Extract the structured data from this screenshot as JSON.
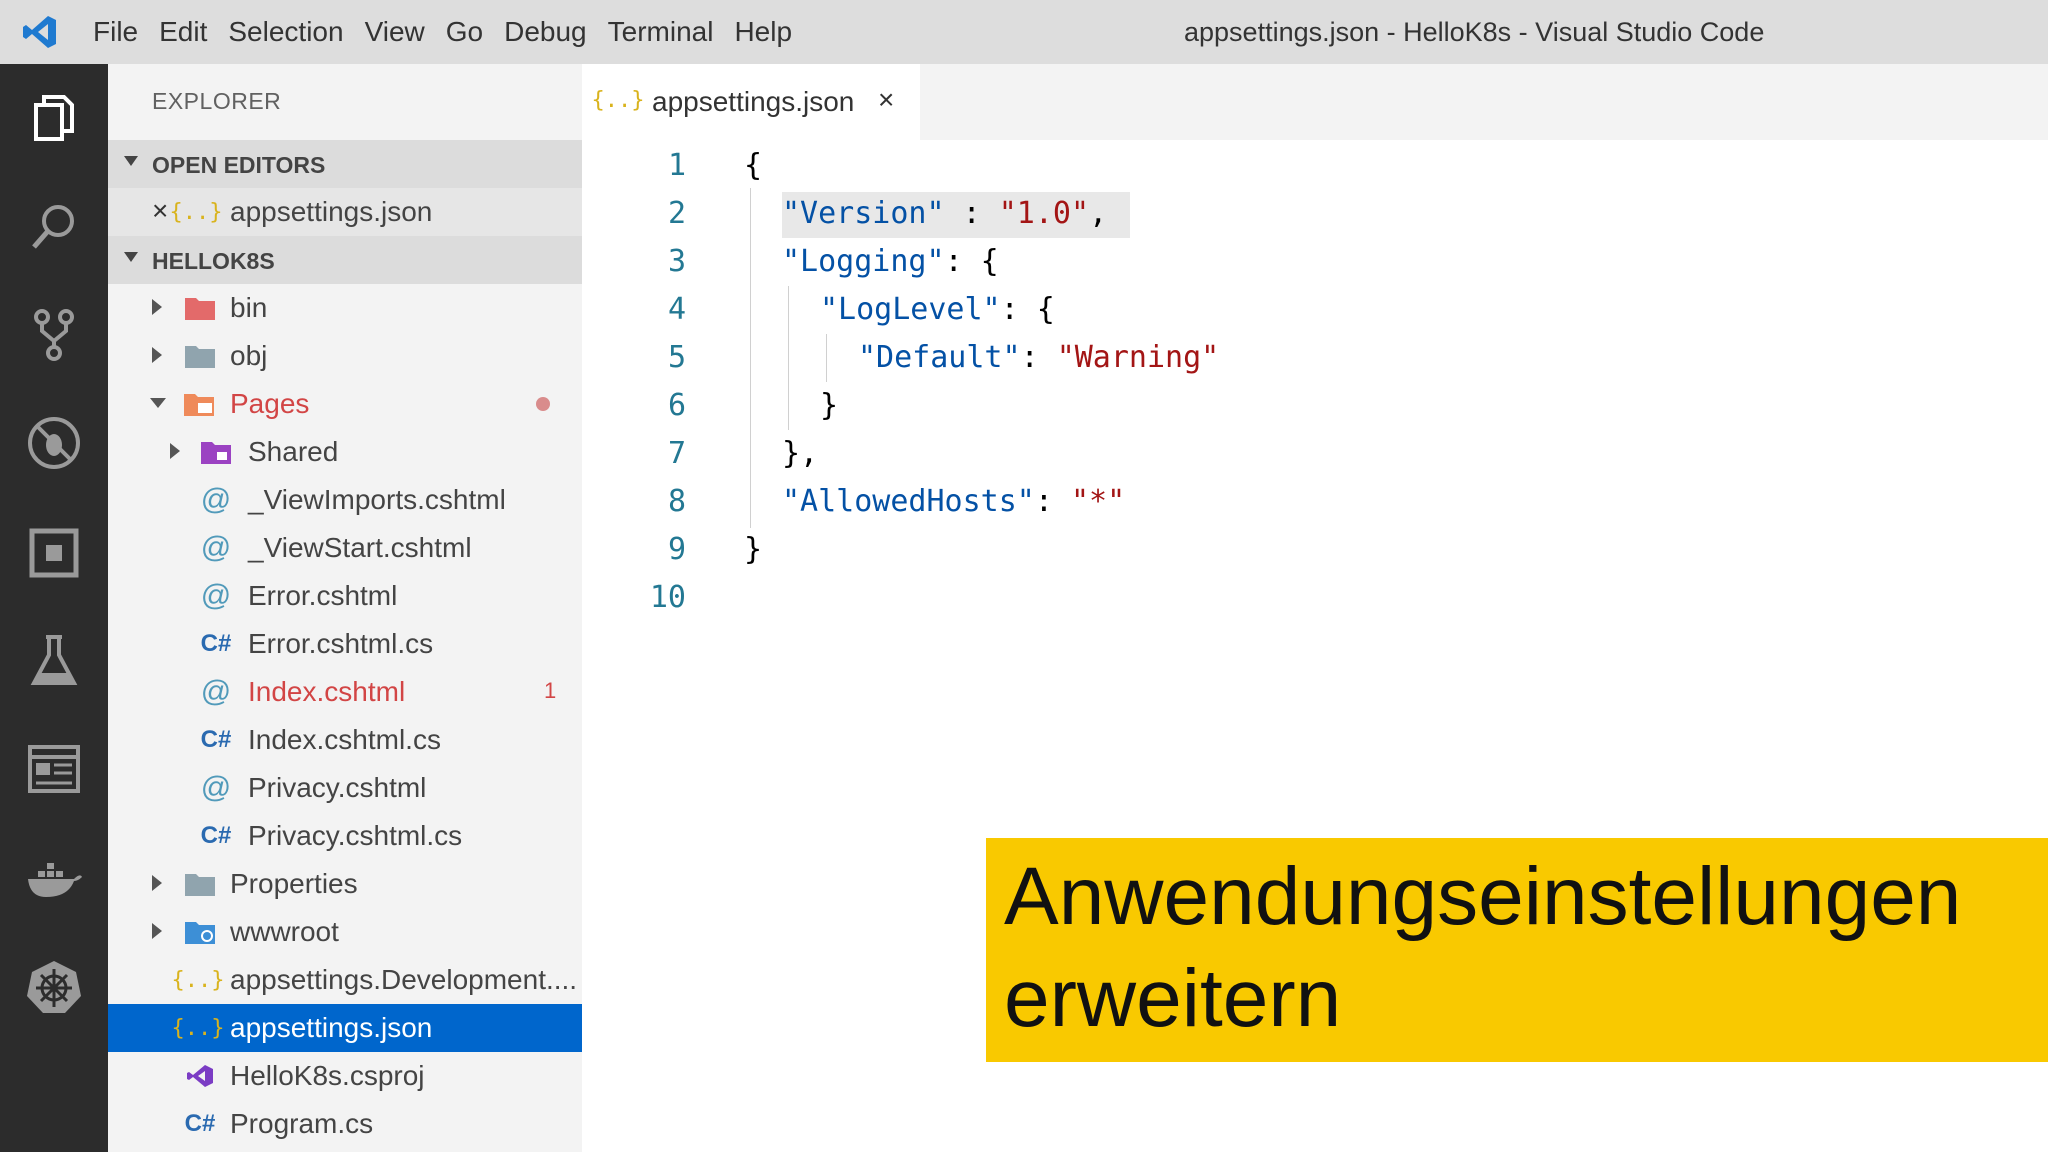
{
  "titlebar": {
    "menu": [
      "File",
      "Edit",
      "Selection",
      "View",
      "Go",
      "Debug",
      "Terminal",
      "Help"
    ],
    "window_title": "appsettings.json - HelloK8s - Visual Studio Code"
  },
  "activitybar": {
    "icons": [
      "explorer-icon",
      "search-icon",
      "source-control-icon",
      "debug-icon",
      "extensions-icon",
      "test-icon",
      "remote-explorer-icon",
      "docker-icon",
      "kubernetes-icon"
    ]
  },
  "sidebar": {
    "title": "EXPLORER",
    "open_editors_label": "OPEN EDITORS",
    "open_editor_file": "appsettings.json",
    "project_label": "HELLOK8S",
    "items": [
      {
        "label": "bin"
      },
      {
        "label": "obj"
      },
      {
        "label": "Pages"
      },
      {
        "label": "Shared"
      },
      {
        "label": "_ViewImports.cshtml"
      },
      {
        "label": "_ViewStart.cshtml"
      },
      {
        "label": "Error.cshtml"
      },
      {
        "label": "Error.cshtml.cs"
      },
      {
        "label": "Index.cshtml",
        "badge": "1"
      },
      {
        "label": "Index.cshtml.cs"
      },
      {
        "label": "Privacy.cshtml"
      },
      {
        "label": "Privacy.cshtml.cs"
      },
      {
        "label": "Properties"
      },
      {
        "label": "wwwroot"
      },
      {
        "label": "appsettings.Development...."
      },
      {
        "label": "appsettings.json"
      },
      {
        "label": "HelloK8s.csproj"
      },
      {
        "label": "Program.cs"
      }
    ]
  },
  "tab": {
    "label": "appsettings.json"
  },
  "editor": {
    "line_numbers": [
      "1",
      "2",
      "3",
      "4",
      "5",
      "6",
      "7",
      "8",
      "9",
      "10"
    ],
    "tokens": {
      "l1": "{",
      "l2_key": "\"Version\"",
      "l2_sep": " : ",
      "l2_val": "\"1.0\"",
      "l2_end": ",",
      "l3_key": "\"Logging\"",
      "l3_end": ": {",
      "l4_key": "\"LogLevel\"",
      "l4_end": ": {",
      "l5_key": "\"Default\"",
      "l5_sep": ": ",
      "l5_val": "\"Warning\"",
      "l6": "}",
      "l7": "},",
      "l8_key": "\"AllowedHosts\"",
      "l8_sep": ": ",
      "l8_val": "\"*\"",
      "l9": "}"
    }
  },
  "caption": {
    "line1": "Anwendungseinstellungen",
    "line2": "erweitern"
  }
}
